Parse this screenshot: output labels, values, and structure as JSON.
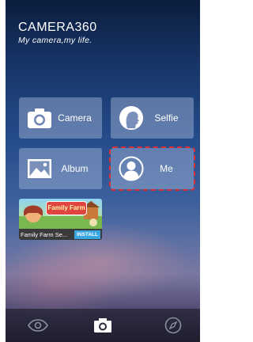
{
  "app": {
    "title": "CAMERA360",
    "tagline": "My camera,my life."
  },
  "tiles": {
    "camera": {
      "label": "Camera",
      "icon": "camera-icon"
    },
    "selfie": {
      "label": "Selfie",
      "icon": "selfie-icon"
    },
    "album": {
      "label": "Album",
      "icon": "album-icon"
    },
    "me": {
      "label": "Me",
      "icon": "person-icon"
    }
  },
  "ad": {
    "logo_text": "Family Farm",
    "name": "Family Farm Se...",
    "install_label": "INSTALL"
  },
  "bottom_nav": {
    "items": [
      {
        "icon": "eye-icon"
      },
      {
        "icon": "camera-icon"
      },
      {
        "icon": "compass-icon"
      }
    ]
  },
  "colors": {
    "highlight_outline": "#d83036",
    "install_button": "#38a6e0"
  }
}
